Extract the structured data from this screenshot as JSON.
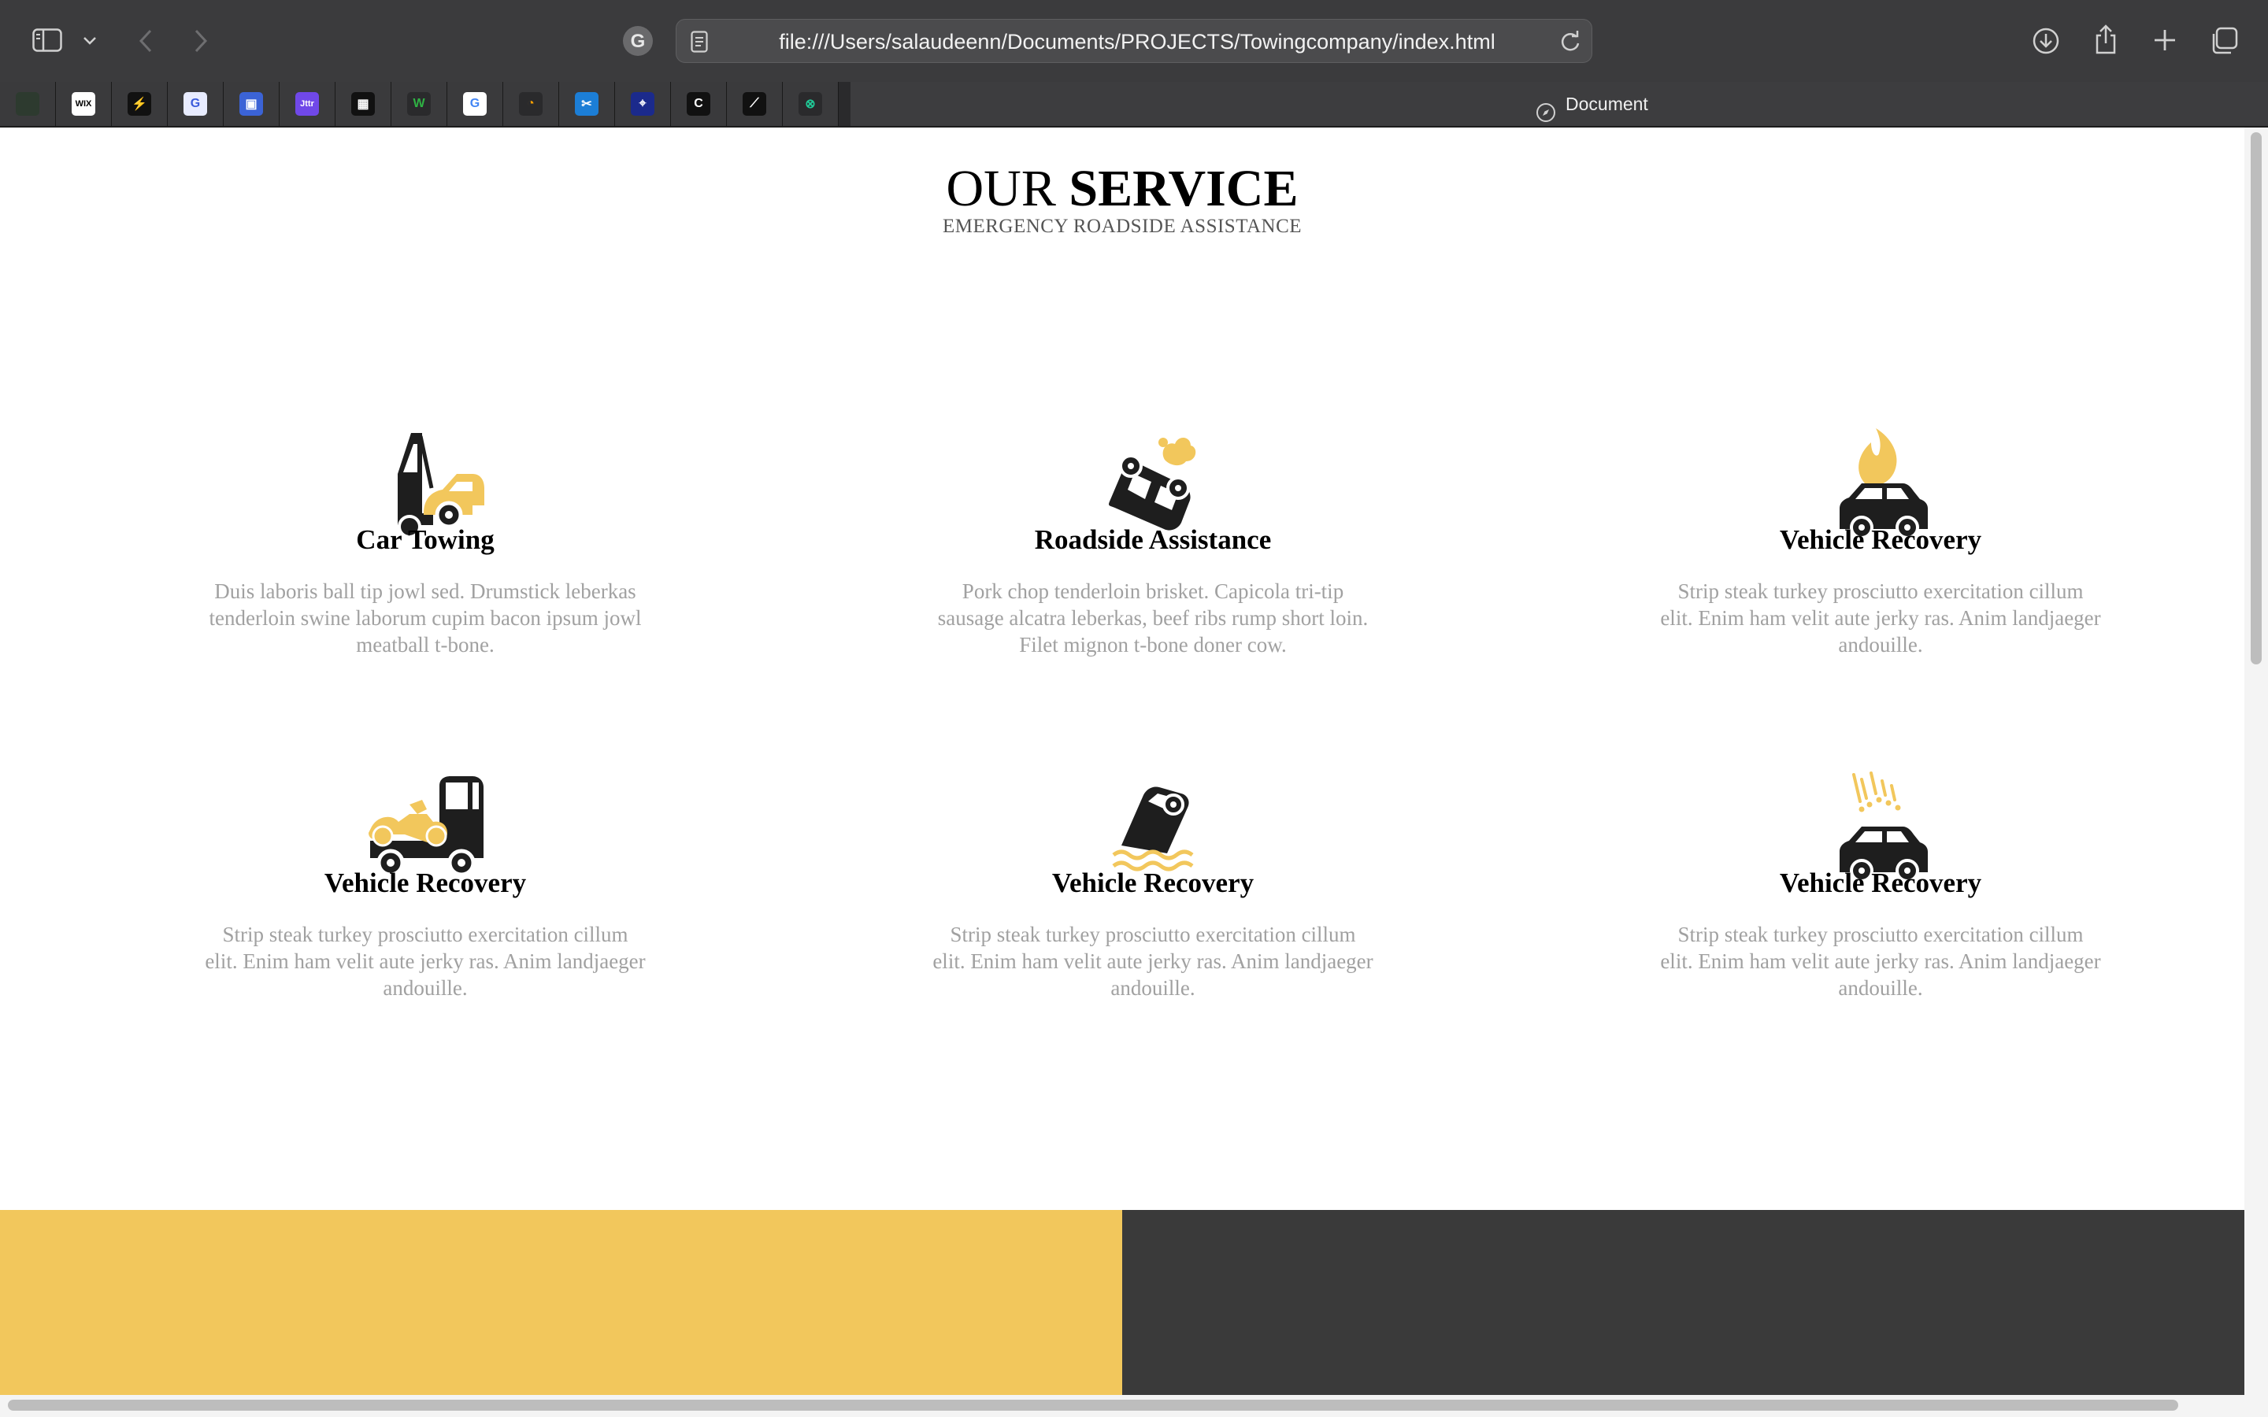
{
  "browser": {
    "url": "file:///Users/salaudeenn/Documents/PROJECTS/Towingcompany/index.html",
    "tab_title": "Document",
    "favorites": [
      {
        "icon": "mountain-app-icon",
        "label": "",
        "bg": "#2d3a2f",
        "fg": "#6fcf6f"
      },
      {
        "icon": "wix-icon",
        "label": "WIX",
        "bg": "#ffffff",
        "fg": "#000000"
      },
      {
        "icon": "lightning-app-icon",
        "label": "⚡",
        "bg": "#111111",
        "fg": "#ffffff"
      },
      {
        "icon": "grammarly-icon",
        "label": "G",
        "bg": "#e8ecff",
        "fg": "#3b5bdb"
      },
      {
        "icon": "google-my-business-icon",
        "label": "▣",
        "bg": "#3b63d6",
        "fg": "#ffffff"
      },
      {
        "icon": "jitter-icon",
        "label": "Jttr",
        "bg": "#7048e8",
        "fg": "#ffffff"
      },
      {
        "icon": "packs-icon",
        "label": "▦",
        "bg": "#111111",
        "fg": "#ffffff"
      },
      {
        "icon": "webflow-icon",
        "label": "W",
        "bg": "#2a2a2c",
        "fg": "#2fb344"
      },
      {
        "icon": "google-icon",
        "label": "G",
        "bg": "#ffffff",
        "fg": "#4285f4"
      },
      {
        "icon": "pie-chart-app-icon",
        "label": "◔",
        "bg": "#2a2a2c",
        "fg": "#f59f00"
      },
      {
        "icon": "capcut-icon",
        "label": "✂",
        "bg": "#1c7ed6",
        "fg": "#ffffff"
      },
      {
        "icon": "codepen-like-icon",
        "label": "⌖",
        "bg": "#1b2a8c",
        "fg": "#ffffff"
      },
      {
        "icon": "c-app-icon",
        "label": "C",
        "bg": "#111111",
        "fg": "#ffffff"
      },
      {
        "icon": "bolt-app-icon",
        "label": "⟋",
        "bg": "#111111",
        "fg": "#ffffff"
      },
      {
        "icon": "location-pin-icon",
        "label": "⊗",
        "bg": "#2a2a2c",
        "fg": "#20c997"
      }
    ]
  },
  "section": {
    "title_normal": "OUR ",
    "title_bold": "SERVICE",
    "subtitle": "EMERGENCY ROADSIDE ASSISTANCE"
  },
  "services": [
    {
      "title": "Car Towing",
      "text": "Duis laboris ball tip jowl sed. Drumstick leberkas tenderloin swine laborum cupim bacon ipsum jowl meatball t-bone.",
      "icon": "tow-truck-icon"
    },
    {
      "title": "Roadside Assistance",
      "text": "Pork chop tenderloin brisket. Capicola tri-tip sausage alcatra leberkas, beef ribs rump short loin. Filet mignon t-bone doner cow.",
      "icon": "overturned-car-icon"
    },
    {
      "title": "Vehicle Recovery",
      "text": "Strip steak turkey prosciutto exercitation cillum elit. Enim ham velit aute jerky ras. Anim landjaeger andouille.",
      "icon": "car-fire-icon"
    },
    {
      "title": "Vehicle Recovery",
      "text": "Strip steak turkey prosciutto exercitation cillum elit. Enim ham velit aute jerky ras. Anim landjaeger andouille.",
      "icon": "motorcycle-transport-truck-icon"
    },
    {
      "title": "Vehicle Recovery",
      "text": "Strip steak turkey prosciutto exercitation cillum elit. Enim ham velit aute jerky ras. Anim landjaeger andouille.",
      "icon": "car-in-water-icon"
    },
    {
      "title": "Vehicle Recovery",
      "text": "Strip steak turkey prosciutto exercitation cillum elit. Enim ham velit aute jerky ras. Anim landjaeger andouille.",
      "icon": "car-hail-icon"
    }
  ],
  "colors": {
    "accent": "#f2c75c",
    "dark": "#3a3a3a",
    "body_text": "#a1a1a1"
  }
}
